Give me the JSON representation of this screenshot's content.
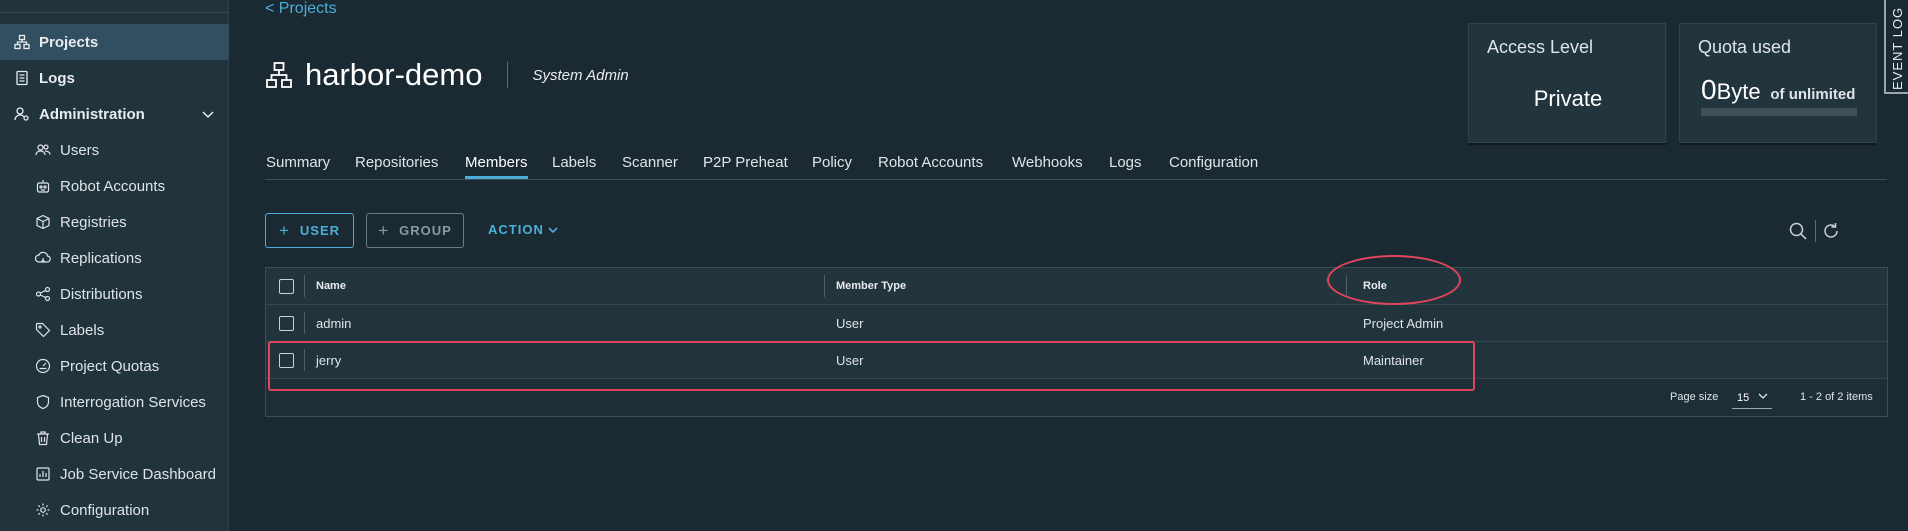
{
  "sidebar": {
    "items": [
      {
        "label": "Projects",
        "icon": "projects-icon"
      },
      {
        "label": "Logs",
        "icon": "logs-icon"
      },
      {
        "label": "Administration",
        "icon": "administration-icon"
      },
      {
        "label": "Users",
        "icon": "users-icon"
      },
      {
        "label": "Robot Accounts",
        "icon": "robot-icon"
      },
      {
        "label": "Registries",
        "icon": "registries-icon"
      },
      {
        "label": "Replications",
        "icon": "replications-icon"
      },
      {
        "label": "Distributions",
        "icon": "distributions-icon"
      },
      {
        "label": "Labels",
        "icon": "labels-icon"
      },
      {
        "label": "Project Quotas",
        "icon": "quotas-icon"
      },
      {
        "label": "Interrogation Services",
        "icon": "shield-icon"
      },
      {
        "label": "Clean Up",
        "icon": "trash-icon"
      },
      {
        "label": "Job Service Dashboard",
        "icon": "dashboard-icon"
      },
      {
        "label": "Configuration",
        "icon": "gear-icon"
      }
    ]
  },
  "header": {
    "back_label": "<  Projects",
    "title": "harbor-demo",
    "role": "System Admin"
  },
  "cards": {
    "access": {
      "title": "Access Level",
      "value": "Private"
    },
    "quota": {
      "title": "Quota used",
      "value": "0",
      "unit": "Byte",
      "of": "of unlimited"
    }
  },
  "event_log": "EVENT LOG",
  "tabs": [
    "Summary",
    "Repositories",
    "Members",
    "Labels",
    "Scanner",
    "P2P Preheat",
    "Policy",
    "Robot Accounts",
    "Webhooks",
    "Logs",
    "Configuration"
  ],
  "active_tab": "Members",
  "toolbar": {
    "user_label": "USER",
    "group_label": "GROUP",
    "action_label": "ACTION"
  },
  "table": {
    "columns": [
      "Name",
      "Member Type",
      "Role"
    ],
    "rows": [
      {
        "name": "admin",
        "type": "User",
        "role": "Project Admin"
      },
      {
        "name": "jerry",
        "type": "User",
        "role": "Maintainer"
      }
    ]
  },
  "pagination": {
    "page_size_label": "Page size",
    "page_size": "15",
    "count": "1 - 2 of 2 items"
  },
  "colors": {
    "accent": "#49afd9",
    "annotation": "#e0455a",
    "background": "#1b2a32",
    "sidebar": "#21333b"
  }
}
